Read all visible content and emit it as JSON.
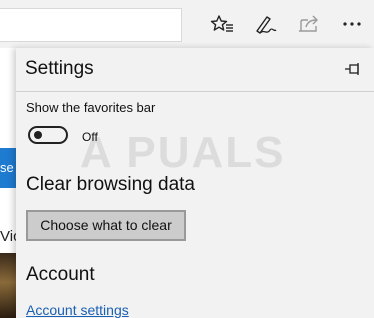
{
  "settings": {
    "title": "Settings",
    "favorites_bar_label": "Show the favorites bar",
    "favorites_bar_toggle_state": "Off",
    "clear_heading": "Clear browsing data",
    "clear_button_label": "Choose what to clear",
    "account_heading": "Account",
    "account_link_label": "Account settings"
  },
  "background_page": {
    "blue_button_fragment": "se",
    "text_fragment": "Vic"
  },
  "watermark": "A PUALS",
  "icons": {
    "favorites": "add-to-favorites-icon",
    "notes": "pen-icon",
    "share": "share-icon",
    "more": "more-icon",
    "pin": "pin-icon"
  },
  "colors": {
    "toolbar_bg": "#f2f2f2",
    "pane_bg": "#f2f2f2",
    "link": "#1a60b3",
    "button_bg": "#cccccc",
    "page_accent": "#1f7bd0"
  }
}
